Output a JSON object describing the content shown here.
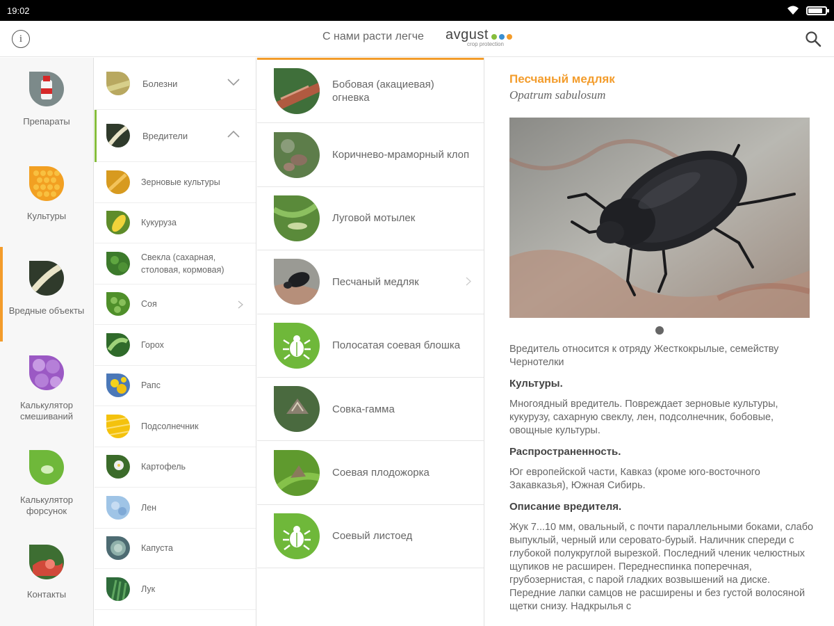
{
  "status": {
    "time": "19:02",
    "battery_level": 0.85
  },
  "header": {
    "slogan": "С нами расти легче",
    "logo_name": "avgust",
    "logo_sub": "crop protection",
    "logo_colors": [
      "#86bd3c",
      "#3a8fd1",
      "#f39c2b"
    ],
    "info_glyph": "i"
  },
  "leftnav": [
    {
      "label": "Препараты",
      "icon": "bottle-icon",
      "active": false
    },
    {
      "label": "Культуры",
      "icon": "corn-icon",
      "active": false
    },
    {
      "label": "Вредные объекты",
      "icon": "larva-icon",
      "active": true
    },
    {
      "label": "Калькулятор смешиваний",
      "icon": "bubbles-icon",
      "active": false
    },
    {
      "label": "Калькулятор форсунок",
      "icon": "droplet-icon",
      "active": false
    },
    {
      "label": "Контакты",
      "icon": "handshake-icon",
      "active": false
    }
  ],
  "categories": {
    "diseases": {
      "label": "Болезни"
    },
    "pests": {
      "label": "Вредители"
    },
    "crops": [
      "Зерновые культуры",
      "Кукуруза",
      "Свекла (сахарная, столовая, кормовая)",
      "Соя",
      "Горох",
      "Рапс",
      "Подсолнечник",
      "Картофель",
      "Лен",
      "Капуста",
      "Лук"
    ]
  },
  "pests": [
    {
      "label": "Бобовая (акациевая) огневка"
    },
    {
      "label": "Коричнево-мраморный клоп"
    },
    {
      "label": "Луговой мотылек"
    },
    {
      "label": "Песчаный медляк"
    },
    {
      "label": "Полосатая соевая блошка"
    },
    {
      "label": "Совка-гамма"
    },
    {
      "label": "Соевая плодожорка"
    },
    {
      "label": "Соевый листоед"
    }
  ],
  "detail": {
    "title": "Песчаный медляк",
    "latin": "Opatrum sabulosum",
    "intro": "Вредитель относится к отряду Жесткокрылые, семейству Чернотелки",
    "h_crops": "Культуры.",
    "crops_text": "Многоядный вредитель. Повреждает зерновые культуры, кукурузу, сахарную свеклу, лен, подсолнечник, бобовые, овощные культуры.",
    "h_spread": "Распространенность.",
    "spread_text": "Юг европейской части, Кавказ (кроме юго-восточного Закавказья), Южная Сибирь.",
    "h_desc": "Описание вредителя.",
    "desc_text": "Жук 7...10 мм, овальный, с почти параллельными боками, слабо выпуклый, черный или серовато-бурый. Наличник спереди с глубокой полукруглой вырезкой. Последний членик челюстных щупиков не расширен. Переднеспинка поперечная, грубозернистая, с парой гладких возвышений на диске. Передние лапки самцов не расширены и без густой волосяной щетки снизу. Надкрылья с"
  },
  "colors": {
    "accent": "#f39c2b",
    "green": "#86bd3c"
  }
}
